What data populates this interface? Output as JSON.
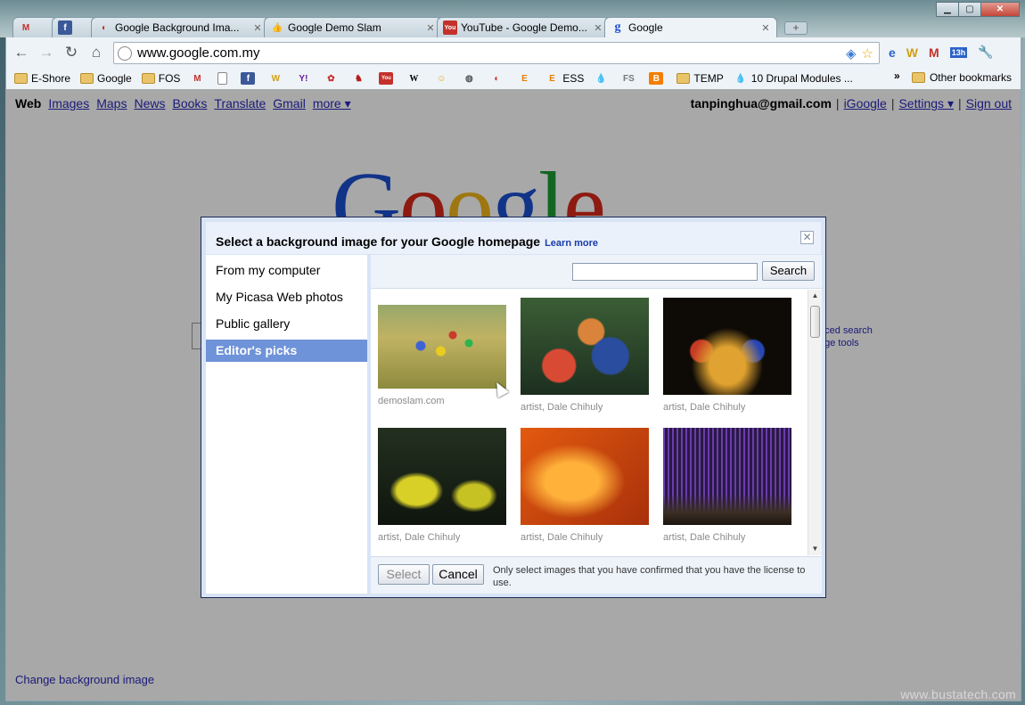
{
  "browser": {
    "tabs": [
      {
        "label": "",
        "icon": "gmail-icon"
      },
      {
        "label": "",
        "icon": "facebook-icon"
      },
      {
        "label": "Google Background Ima...",
        "icon": "drupal-icon"
      },
      {
        "label": "Google Demo Slam",
        "icon": "thumbs-up-icon"
      },
      {
        "label": "YouTube - Google Demo...",
        "icon": "youtube-icon"
      },
      {
        "label": "Google",
        "icon": "google-icon"
      }
    ],
    "url": "www.google.com.my",
    "ext_badge": "13h"
  },
  "bookmarks": {
    "items": [
      "E-Shore",
      "Google",
      "FOS",
      "",
      "",
      "",
      "",
      "",
      "",
      "",
      "",
      "",
      "",
      "",
      "",
      "",
      "ESS",
      "",
      "",
      "",
      "TEMP",
      "10 Drupal Modules ..."
    ],
    "other": "Other bookmarks",
    "more": "»"
  },
  "gbar": {
    "current": "Web",
    "links": [
      "Images",
      "Maps",
      "News",
      "Books",
      "Translate",
      "Gmail",
      "more ▾"
    ],
    "email": "tanpinghua@gmail.com",
    "right_links": [
      "iGoogle",
      "Settings ▾",
      "Sign out"
    ]
  },
  "page": {
    "logo_letters": [
      "G",
      "o",
      "o",
      "g",
      "l",
      "e"
    ],
    "adv_search": "nced search",
    "lang_tools": "age tools",
    "change_bg": "Change background image"
  },
  "dialog": {
    "title": "Select a background image for your Google homepage",
    "learn_more": "Learn more",
    "close": "✕",
    "sidebar": [
      "From my computer",
      "My Picasa Web photos",
      "Public gallery",
      "Editor's picks"
    ],
    "selected": "Editor's picks",
    "search_placeholder": "",
    "search_button": "Search",
    "images": [
      {
        "caption": "demoslam.com",
        "art": "img-demoslam"
      },
      {
        "caption": "artist, Dale Chihuly",
        "art": "img-orbs"
      },
      {
        "caption": "artist, Dale Chihuly",
        "art": "img-boat"
      },
      {
        "caption": "artist, Dale Chihuly",
        "art": "img-lily"
      },
      {
        "caption": "artist, Dale Chihuly",
        "art": "img-orange"
      },
      {
        "caption": "artist, Dale Chihuly",
        "art": "img-purple"
      }
    ],
    "select_button": "Select",
    "cancel_button": "Cancel",
    "license_note": "Only select images that you have confirmed that you have the license to use."
  },
  "watermark": "www.bustatech.com"
}
